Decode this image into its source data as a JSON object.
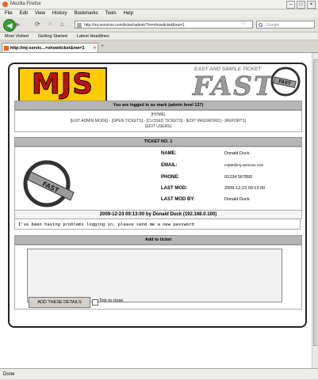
{
  "browser": {
    "window_title": "Mozilla Firefox",
    "menu": [
      "File",
      "Edit",
      "View",
      "History",
      "Bookmarks",
      "Tools",
      "Help"
    ],
    "url": "http://mj-services.com/ticket/admin/?m=showticket&nw=1",
    "search_placeholder": "Google",
    "bookmarks": [
      "Most Visited",
      "Getting Started",
      "Latest Headlines"
    ],
    "tab_title": "http://mj-servic...=showticket&nw=1",
    "status": "Done"
  },
  "header": {
    "logo_text": "MJS",
    "fast_subtitle": "EAST AND SIMPLE TICKET",
    "fast_title": "FAST",
    "badge_text": "FAST"
  },
  "login": {
    "heading": "You are logged in as mark (admin level 127)",
    "nav_home": "[HOME]",
    "nav_links": "[EXIT ADMIN MODE] - [OPEN TICKETS] - [CLOSED TICKETS] - [EDIT PASSWORD] - [REPORTS]",
    "nav_users": "[EDIT USERS]"
  },
  "ticket": {
    "heading": "TICKET NO. 1",
    "fields": [
      {
        "label": "NAME:",
        "value": "Donald Duck"
      },
      {
        "label": "EMAIL:",
        "value": "mrj86@mj-services.com"
      },
      {
        "label": "PHONE:",
        "value": "01234 567890"
      },
      {
        "label": "LAST MOD:",
        "value": "2009-12-23 09:13:00"
      },
      {
        "label": "LAST MOD BY:",
        "value": "Donald Duck"
      }
    ]
  },
  "message": {
    "heading": "2009-12-23 09:13:00 by Donald Duck (192.168.0.100)",
    "body": "I've been having problems logging in, please send me a new password"
  },
  "add": {
    "heading": "Add to ticket",
    "submit_label": "ADD THESE DETAILS",
    "checkbox_label": "Tick to close"
  }
}
